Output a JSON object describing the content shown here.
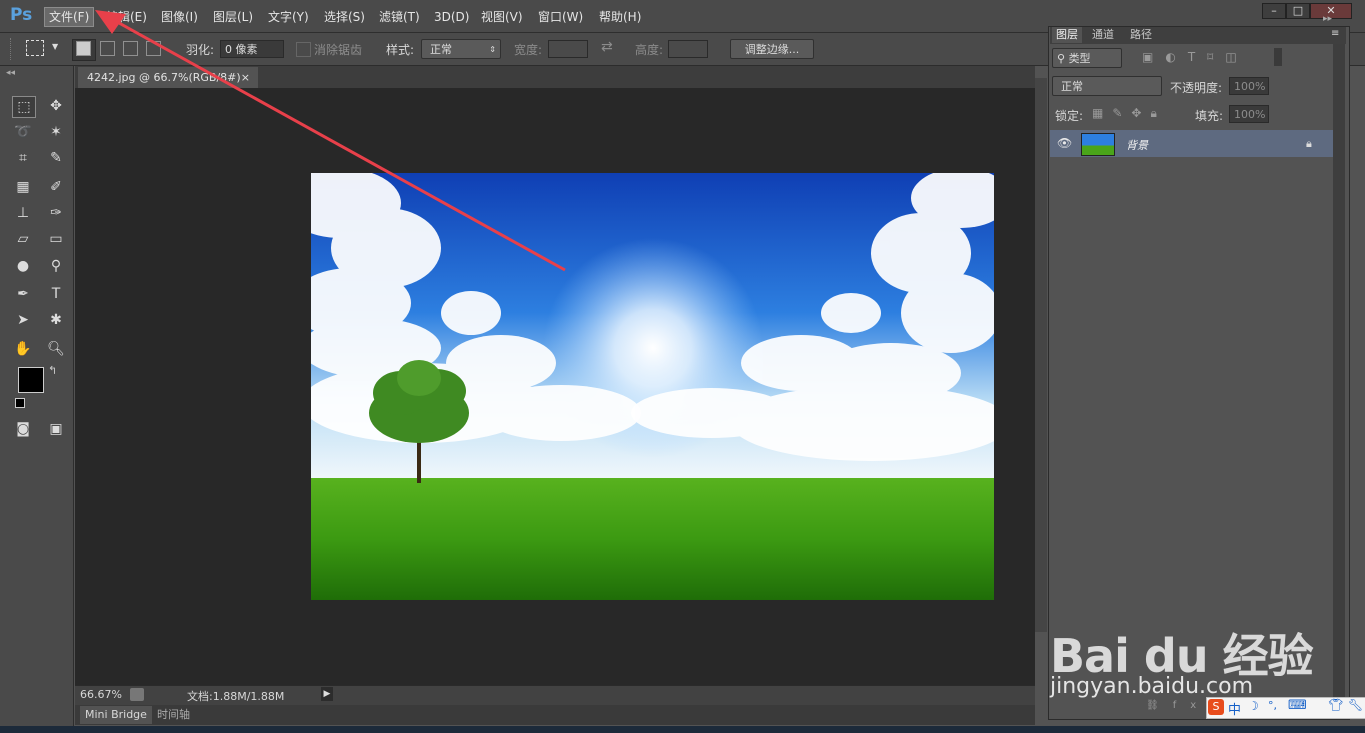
{
  "app": {
    "logo": "Ps"
  },
  "menu": {
    "items": [
      "文件(F)",
      "编辑(E)",
      "图像(I)",
      "图层(L)",
      "文字(Y)",
      "选择(S)",
      "滤镜(T)",
      "3D(D)",
      "视图(V)",
      "窗口(W)",
      "帮助(H)"
    ],
    "active_index": 0
  },
  "window_controls": {
    "minimize": "–",
    "maximize": "□",
    "close": "✕"
  },
  "options": {
    "feather_label": "羽化:",
    "feather_value": "0 像素",
    "antialias_label": "消除锯齿",
    "style_label": "样式:",
    "style_value": "正常",
    "width_label": "宽度:",
    "height_label": "高度:",
    "refine_button": "调整边缘..."
  },
  "document": {
    "tab_title": "4242.jpg @ 66.7%(RGB/8#)",
    "tab_close": "×",
    "zoom": "66.67%",
    "doc_size": "文档:1.88M/1.88M"
  },
  "bottom_tabs": [
    "Mini Bridge",
    "时间轴"
  ],
  "layers_panel": {
    "tabs": [
      "图层",
      "通道",
      "路径"
    ],
    "filter_label": "类型",
    "blend_mode": "正常",
    "opacity_label": "不透明度:",
    "opacity_value": "100%",
    "lock_label": "锁定:",
    "fill_label": "填充:",
    "fill_value": "100%",
    "layers": [
      {
        "name": "背景",
        "locked": true,
        "visible": true
      }
    ]
  },
  "watermark": {
    "text": "jingyan.baidu.com",
    "brand": "Bai du 经验"
  },
  "ime": {
    "items": [
      "S",
      "中",
      "☽",
      "°,",
      "⌨",
      "👕",
      "🔧"
    ]
  },
  "colors": {
    "accent_ps": "#5aa1de",
    "annotation_arrow": "#e8404a",
    "layer_selected": "#5e6a80"
  }
}
